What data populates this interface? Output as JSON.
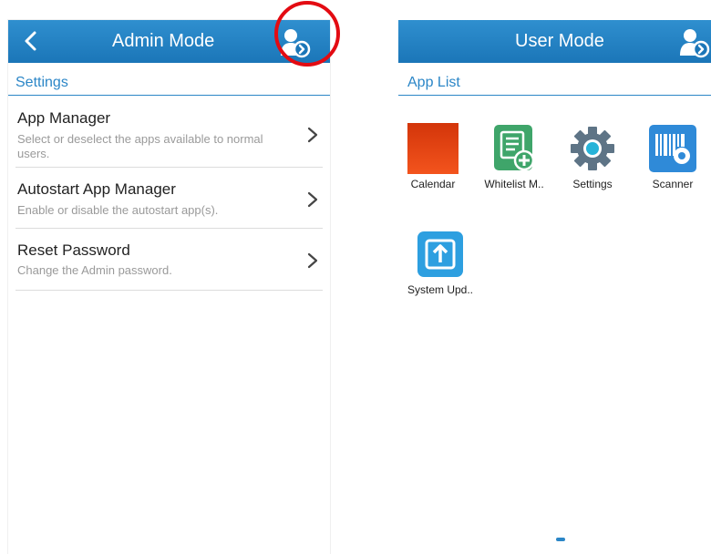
{
  "admin_screen": {
    "title": "Admin Mode",
    "section_label": "Settings",
    "items": [
      {
        "title": "App Manager",
        "description": "Select or deselect the apps available to normal users."
      },
      {
        "title": "Autostart App Manager",
        "description": "Enable or disable the autostart app(s)."
      },
      {
        "title": "Reset Password",
        "description": "Change the Admin password."
      }
    ]
  },
  "user_screen": {
    "title": "User Mode",
    "section_label": "App List",
    "apps": [
      {
        "label": "Calendar",
        "icon": "calendar-icon"
      },
      {
        "label": "Whitelist M..",
        "icon": "whitelist-icon"
      },
      {
        "label": "Settings",
        "icon": "settings-gear-icon"
      },
      {
        "label": "Scanner",
        "icon": "scanner-icon"
      },
      {
        "label": "System Upd..",
        "icon": "system-update-icon"
      }
    ]
  },
  "colors": {
    "app_bar": "#1f7cc0",
    "accent": "#2b86c7",
    "highlight": "#e30b12"
  }
}
